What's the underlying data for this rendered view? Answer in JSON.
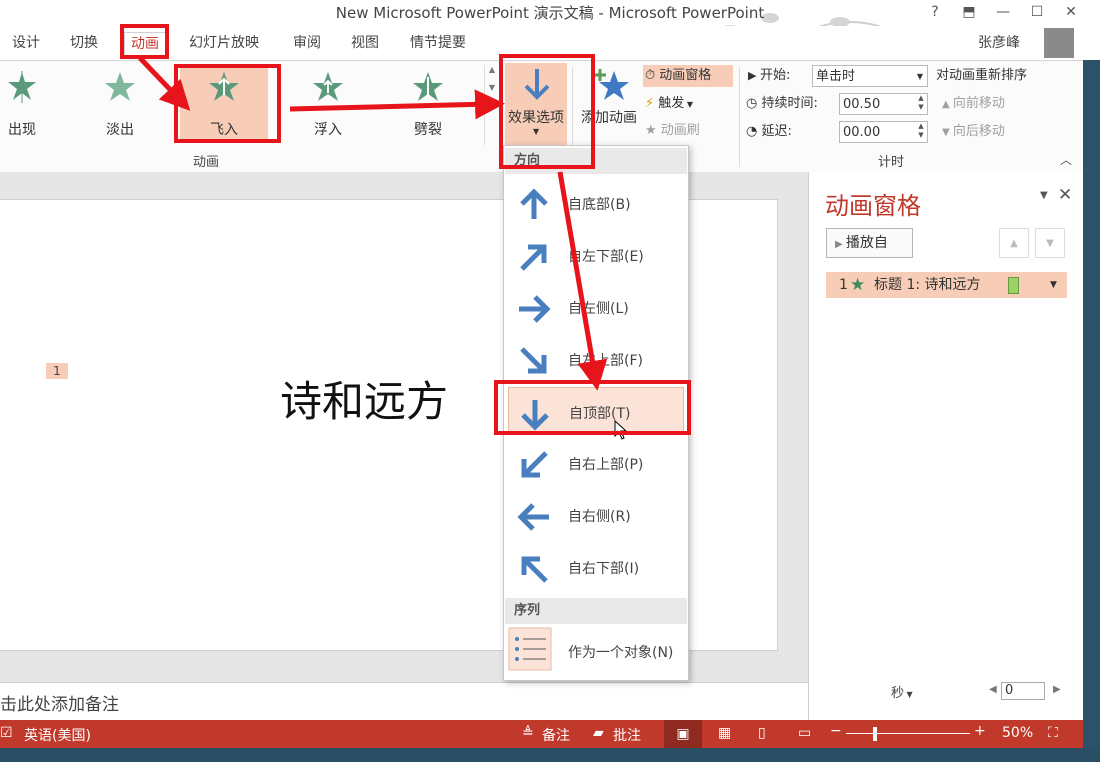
{
  "window": {
    "title": "New Microsoft PowerPoint 演示文稿 - Microsoft PowerPoint",
    "help": "?",
    "user": "张彦峰"
  },
  "tabs": [
    "设计",
    "切换",
    "动画",
    "幻灯片放映",
    "审阅",
    "视图",
    "情节提要"
  ],
  "ribbon": {
    "gallery": [
      "出现",
      "淡出",
      "飞入",
      "浮入",
      "劈裂"
    ],
    "group_animation": "动画",
    "effect_options": "效果选项",
    "add_animation": "添加动画",
    "advanced": {
      "pane": "动画窗格",
      "trigger": "触发",
      "painter": "动画刷"
    },
    "timing": {
      "start_label": "开始:",
      "start_value": "单击时",
      "duration_label": "持续时间:",
      "duration_value": "00.50",
      "delay_label": "延迟:",
      "delay_value": "00.00",
      "group_label": "计时",
      "reorder": "对动画重新排序",
      "move_earlier": "向前移动",
      "move_later": "向后移动"
    }
  },
  "dropdown": {
    "direction_header": "方向",
    "items": [
      "自底部(B)",
      "自左下部(E)",
      "自左侧(L)",
      "自左上部(F)",
      "自顶部(T)",
      "自右上部(P)",
      "自右侧(R)",
      "自右下部(I)"
    ],
    "sequence_header": "序列",
    "sequence_item": "作为一个对象(N)"
  },
  "slide": {
    "title": "诗和远方",
    "marker": "1",
    "notes_placeholder": "击此处添加备注"
  },
  "pane": {
    "title": "动画窗格",
    "play": "播放自",
    "item_index": "1",
    "item_label": "标题 1: 诗和远方",
    "seconds": "秒",
    "timeline_value": "0"
  },
  "status": {
    "language": "英语(美国)",
    "notes": "备注",
    "comments": "批注",
    "zoom": "50%"
  },
  "colors": {
    "accent": "#c0392b",
    "highlight": "#f7cdb7",
    "annotation": "#e8141b",
    "arrow_blue": "#4a7fbf"
  }
}
